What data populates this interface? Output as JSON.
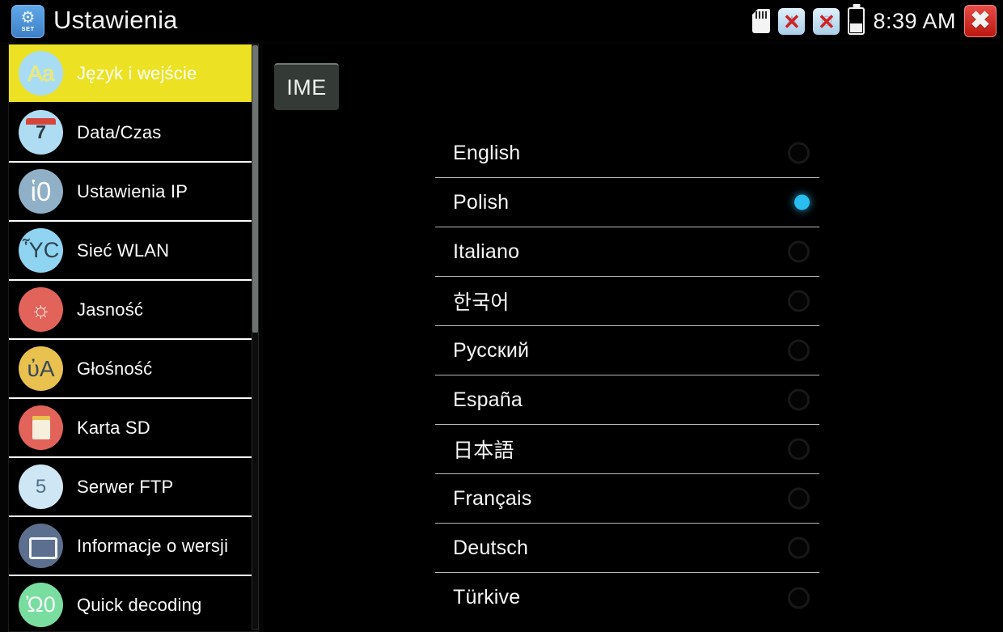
{
  "titlebar": {
    "app_icon": "settings-gear-icon",
    "app_icon_label": "SET",
    "gear_glyph": "⚙",
    "title": "Ustawienia"
  },
  "statusbar": {
    "sdcard_icon": "sd-card-icon",
    "network1": {
      "icon": "network-disabled-icon",
      "symbol": "⛰",
      "x": "✕"
    },
    "network2": {
      "icon": "network-disabled-icon",
      "symbol": "◎",
      "x": "✕"
    },
    "battery_icon": "battery-icon",
    "clock": "8:39 AM",
    "close_label": "✖"
  },
  "sidebar": {
    "items": [
      {
        "label": "Język i wejście",
        "icon": "language-input-icon",
        "glyph": "Aa",
        "icon_class": "ico-aa",
        "active": true
      },
      {
        "label": "Data/Czas",
        "icon": "calendar-clock-icon",
        "glyph": "7",
        "icon_class": "ico-cal",
        "active": false
      },
      {
        "label": "Ustawienia IP",
        "icon": "globe-icon",
        "glyph": "ἱ0",
        "icon_class": "ico-globe",
        "active": false
      },
      {
        "label": "Sieć WLAN",
        "icon": "wifi-antenna-icon",
        "glyph": "ὟC",
        "icon_class": "ico-wifi",
        "active": false
      },
      {
        "label": "Jasność",
        "icon": "brightness-icon",
        "glyph": "☼",
        "icon_class": "ico-bright",
        "active": false
      },
      {
        "label": "Głośność",
        "icon": "volume-icon",
        "glyph": "ὐA",
        "icon_class": "ico-vol",
        "active": false
      },
      {
        "label": "Karta SD",
        "icon": "sd-card-icon",
        "glyph": "",
        "icon_class": "ico-sd",
        "active": false
      },
      {
        "label": "Serwer FTP",
        "icon": "ftp-server-icon",
        "glyph": "὚5",
        "icon_class": "ico-ftp",
        "active": false
      },
      {
        "label": "Informacje o wersji",
        "icon": "version-info-icon",
        "glyph": "",
        "icon_class": "ico-ver",
        "active": false
      },
      {
        "label": "Quick decoding",
        "icon": "rocket-icon",
        "glyph": "Ὠ0",
        "icon_class": "ico-rocket",
        "active": false
      }
    ]
  },
  "main": {
    "ime_button_label": "IME",
    "languages": [
      {
        "label": "English",
        "selected": false
      },
      {
        "label": "Polish",
        "selected": true
      },
      {
        "label": "Italiano",
        "selected": false
      },
      {
        "label": "한국어",
        "selected": false
      },
      {
        "label": "Русский",
        "selected": false
      },
      {
        "label": "España",
        "selected": false
      },
      {
        "label": "日本語",
        "selected": false
      },
      {
        "label": "Français",
        "selected": false
      },
      {
        "label": "Deutsch",
        "selected": false
      },
      {
        "label": "Türkive",
        "selected": false
      }
    ]
  },
  "colors": {
    "highlight_yellow": "#ece122",
    "selected_dot": "#29bdf0",
    "close_red": "#bc1710",
    "text_white": "#f6f6f6"
  }
}
